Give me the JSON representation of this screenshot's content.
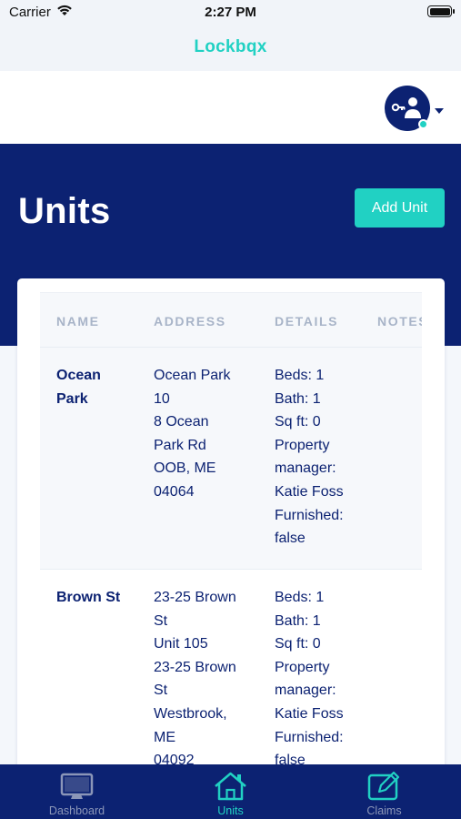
{
  "status_bar": {
    "carrier": "Carrier",
    "time": "2:27 PM"
  },
  "nav": {
    "title": "Lockbqx"
  },
  "page": {
    "title": "Units",
    "add_button": "Add Unit"
  },
  "table": {
    "columns": [
      "NAME",
      "ADDRESS",
      "DETAILS",
      "NOTES"
    ],
    "rows": [
      {
        "name": [
          "Ocean",
          "Park"
        ],
        "address": [
          "Ocean Park",
          "10",
          "8 Ocean",
          "Park Rd",
          "OOB, ME",
          "04064"
        ],
        "details": [
          "Beds: 1",
          "Bath: 1",
          "Sq ft: 0",
          "Property",
          "manager:",
          "Katie Foss",
          "Furnished:",
          "false"
        ]
      },
      {
        "name": [
          "Brown St"
        ],
        "address": [
          "23-25 Brown",
          "St",
          "Unit 105",
          "23-25 Brown",
          "St",
          "Westbrook,",
          "ME",
          "04092"
        ],
        "details": [
          "Beds: 1",
          "Bath: 1",
          "Sq ft: 0",
          "Property",
          "manager:",
          "Katie Foss",
          "Furnished:",
          "false"
        ]
      }
    ]
  },
  "tabs": [
    {
      "label": "Dashboard",
      "icon": "monitor-icon",
      "active": false
    },
    {
      "label": "Units",
      "icon": "home-icon",
      "active": true
    },
    {
      "label": "Claims",
      "icon": "edit-icon",
      "active": false
    }
  ],
  "colors": {
    "brand_navy": "#0c2272",
    "accent_teal": "#21d1c3",
    "inactive_tab": "#8b96b8"
  }
}
